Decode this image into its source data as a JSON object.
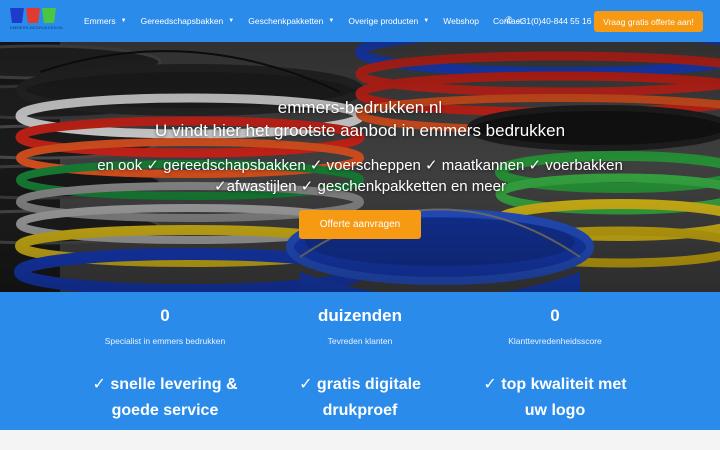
{
  "brand": {
    "logo_text": "EMMERS-BEDRUKKEN.NL"
  },
  "nav": {
    "items": [
      {
        "label": "Emmers",
        "caret": "▼"
      },
      {
        "label": "Gereedschapsbakken",
        "caret": "▼"
      },
      {
        "label": "Geschenkpakketten",
        "caret": "▼"
      },
      {
        "label": "Overige producten",
        "caret": "▼"
      },
      {
        "label": "Webshop",
        "caret": ""
      },
      {
        "label": "Contact",
        "caret": ""
      }
    ],
    "phone": "+31(0)40-844 55 16",
    "cta_label": "Vraag gratis offerte aan!"
  },
  "hero": {
    "title": "emmers-bedrukken.nl",
    "subtitle": "U vindt hier het grootste aanbod in emmers bedrukken",
    "line1": "en ook ✓ gereedschapsbakken ✓ voerscheppen ✓  maatkannen ✓ voerbakken",
    "line2": "✓afwastijlen ✓ geschenkpakketten en meer",
    "button_label": "Offerte aanvragen"
  },
  "stats": [
    {
      "value": "0",
      "label": "Specialist in emmers bedrukken"
    },
    {
      "value": "duizenden",
      "label": "Tevreden klanten"
    },
    {
      "value": "0",
      "label": "Klanttevredenheidsscore"
    }
  ],
  "features": [
    {
      "line1": "✓ snelle levering &",
      "line2": "goede service"
    },
    {
      "line1": "✓  gratis digitale",
      "line2": "drukproef"
    },
    {
      "line1": "✓ top kwaliteit met",
      "line2": "uw logo"
    }
  ],
  "colors": {
    "brand_blue": "#2b8bea",
    "accent_orange": "#f59a12"
  }
}
